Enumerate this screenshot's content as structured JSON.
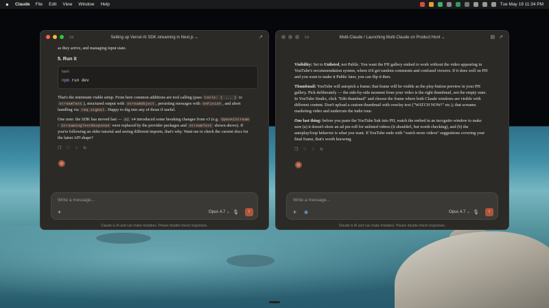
{
  "menubar": {
    "apple_icon": "apple-logo",
    "app": "Claude",
    "items": [
      "File",
      "Edit",
      "View",
      "Window",
      "Help"
    ],
    "datetime": "Tue May 19  11:34 PM"
  },
  "left_window": {
    "title": "Setting up Vercel AI SDK streaming in Next.js",
    "top_fragment": "as they arrive, and managing input state.",
    "heading": "5. Run it",
    "code_lang": "bash",
    "code_cmd": "npm",
    "code_rest": " run dev",
    "p1": {
      "a": "That's the minimum viable setup. From here common additions are tool calling (pass ",
      "c1": "tools: { ... }",
      "b": " to ",
      "c2": "streamText",
      "c": "), structured output with ",
      "c3": "streamObject",
      "d": ", persisting messages with ",
      "c4": "onFinish",
      "e": ", and abort handling via ",
      "c5": "req.signal",
      "f": ". Happy to dig into any of those if useful."
    },
    "p2": {
      "a": "One note: the SDK has moved fast — ",
      "c1": "ai",
      "b": " v4 introduced some breaking changes from v3 (e.g. ",
      "c2": "OpenAIStream",
      "sep": " / ",
      "c3": "StreamingTextResponse",
      "c": " were replaced by the provider packages and ",
      "c4": "streamText",
      "d": " shown above). If you're following an older tutorial and seeing different imports, that's why. Want me to check the current docs for the latest API shape?"
    },
    "placeholder": "Write a message...",
    "model": "Opus 4.7",
    "disclaimer": "Claude is AI and can make mistakes. Please double-check responses."
  },
  "right_window": {
    "breadcrumb_root": "Multi-Claude",
    "breadcrumb_sep": "/",
    "title": "Launching Multi-Claude on Product Hunt",
    "p1": {
      "label": "Visibility:",
      "a": " Set to ",
      "bold": "Unlisted",
      "b": ", not Public. You want the PH gallery embed to work without the video appearing in YouTube's recommendation system, where it'd get random comments and confused viewers. If it does well on PH and you want to make it Public later, you can flip it then."
    },
    "p2": {
      "label": "Thumbnail:",
      "text": " YouTube will autopick a frame; that frame will be visible as the play-button preview in your PH gallery. Pick deliberately — the side-by-side moment from your video is the right thumbnail, not the empty state. In YouTube Studio, click \"Edit thumbnail\" and choose the frame where both Claude windows are visible with different content. Don't upload a custom thumbnail with overlay text (\"WATCH NOW!\" etc.); that screams marketing video and undercuts the indie tone."
    },
    "p3": {
      "label": "One last thing:",
      "text": " before you paste the YouTube link into PH, watch the embed in an incognito window to make sure (a) it doesn't show an ad pre-roll for unlisted videos (it shouldn't, but worth checking), and (b) the autoplay/loop behavior is what you want. If YouTube ends with \"watch more videos\" suggestions covering your final frame, that's worth knowing."
    },
    "placeholder": "Write a message...",
    "model": "Opus 4.7",
    "disclaimer": "Claude is AI and can make mistakes. Please double-check responses."
  },
  "colors": {
    "accent": "#d97757",
    "send": "#b0553a",
    "window_bg": "#2b2a27"
  }
}
